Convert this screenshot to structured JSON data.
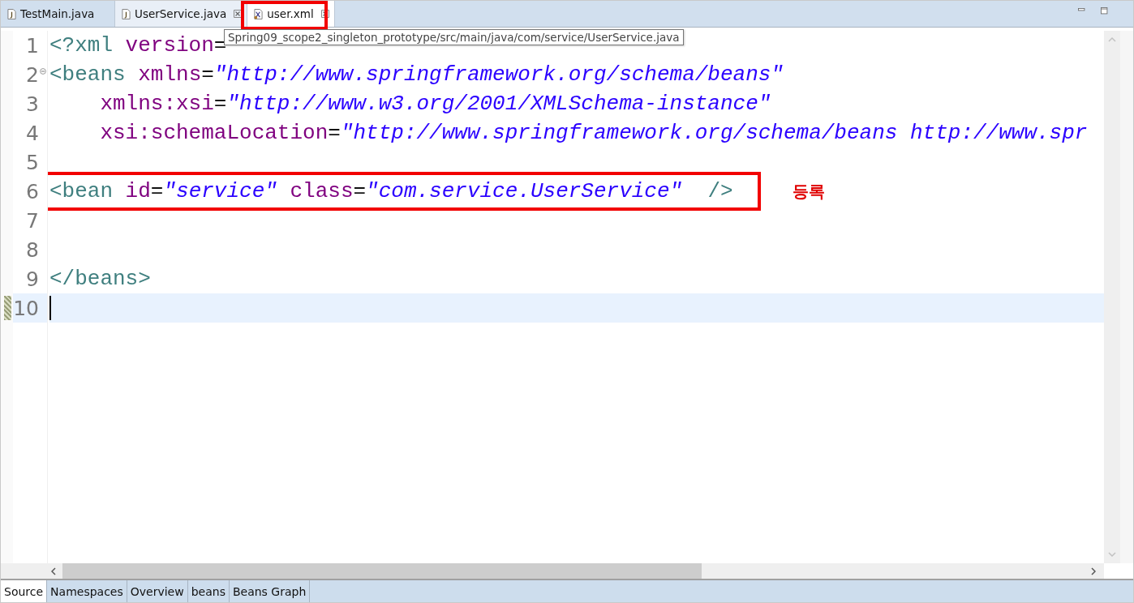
{
  "editor_tabs": [
    {
      "label": "TestMain.java",
      "selected": false,
      "hovered": false,
      "closable": false
    },
    {
      "label": "UserService.java",
      "selected": false,
      "hovered": true,
      "closable": true
    },
    {
      "label": "user.xml",
      "selected": true,
      "hovered": false,
      "closable": true
    }
  ],
  "tooltip": "Spring09_scope2_singleton_prototype/src/main/java/com/service/UserService.java",
  "code_lines": [
    {
      "number": "1",
      "fold": false,
      "current": false,
      "indented": false,
      "tokens": [
        {
          "kind": "tag",
          "text": "<?xml"
        },
        {
          "kind": "attr",
          "text": "version"
        },
        {
          "kind": "punct",
          "text": "="
        }
      ]
    },
    {
      "number": "2",
      "fold": true,
      "current": false,
      "indented": false,
      "tokens": [
        {
          "kind": "tag",
          "text": "<beans"
        },
        {
          "kind": "attr",
          "text": "xmlns"
        },
        {
          "kind": "punct",
          "text": "="
        },
        {
          "kind": "value",
          "text": "\"http://www.springframework.org/schema/beans\""
        }
      ]
    },
    {
      "number": "3",
      "fold": false,
      "current": false,
      "indented": true,
      "tokens": [
        {
          "kind": "attr",
          "text": "xmlns:xsi"
        },
        {
          "kind": "punct",
          "text": "="
        },
        {
          "kind": "value",
          "text": "\"http://www.w3.org/2001/XMLSchema-instance\""
        }
      ]
    },
    {
      "number": "4",
      "fold": false,
      "current": false,
      "indented": true,
      "tokens": [
        {
          "kind": "attr",
          "text": "xsi:schemaLocation"
        },
        {
          "kind": "punct",
          "text": "="
        },
        {
          "kind": "value",
          "text": "\"http://www.springframework.org/schema/beans http://www.spr"
        }
      ]
    },
    {
      "number": "5",
      "fold": false,
      "current": false,
      "indented": false
    },
    {
      "number": "6",
      "fold": false,
      "current": false,
      "indented": false,
      "tokens": [
        {
          "kind": "tag",
          "text": "<bean"
        },
        {
          "kind": "attr",
          "text": "id"
        },
        {
          "kind": "punct",
          "text": "="
        },
        {
          "kind": "value",
          "text": "\"service\""
        },
        {
          "kind": "attr",
          "text": "class"
        },
        {
          "kind": "punct",
          "text": "="
        },
        {
          "kind": "value",
          "text": "\"com.service.UserService\""
        },
        {
          "kind": "tag",
          "text": "/>"
        }
      ]
    },
    {
      "number": "7",
      "fold": false,
      "current": false,
      "indented": false
    },
    {
      "number": "8",
      "fold": false,
      "current": false,
      "indented": false
    },
    {
      "number": "9",
      "fold": false,
      "current": false,
      "indented": false,
      "tokens": [
        {
          "kind": "tag",
          "text": "</beans>"
        }
      ]
    },
    {
      "number": "10",
      "fold": false,
      "current": true,
      "indented": false
    }
  ],
  "annotation": "등록",
  "bottom_tabs": [
    {
      "label": "Source",
      "selected": true
    },
    {
      "label": "Namespaces",
      "selected": false
    },
    {
      "label": "Overview",
      "selected": false
    },
    {
      "label": "beans",
      "selected": false
    },
    {
      "label": "Beans Graph",
      "selected": false
    }
  ]
}
